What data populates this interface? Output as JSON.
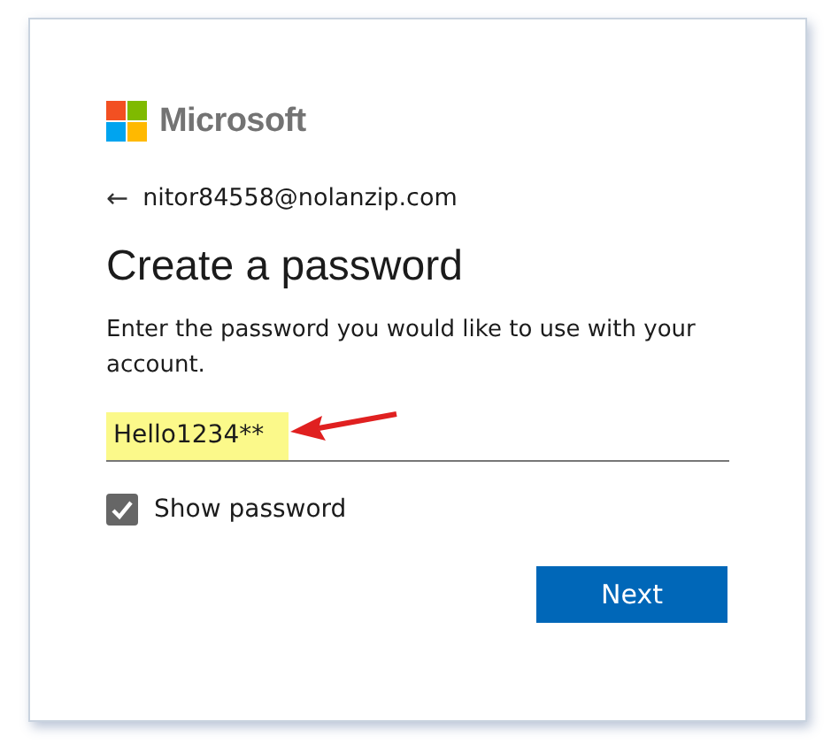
{
  "logo": {
    "text": "Microsoft"
  },
  "account": {
    "back": "←",
    "email": "nitor84558@nolanzip.com"
  },
  "heading": "Create a password",
  "description": "Enter the password you would like to use with your account.",
  "password": {
    "value": "Hello1234**",
    "highlighted": true
  },
  "show_password": {
    "label": "Show password",
    "checked": true
  },
  "next_button": "Next"
}
